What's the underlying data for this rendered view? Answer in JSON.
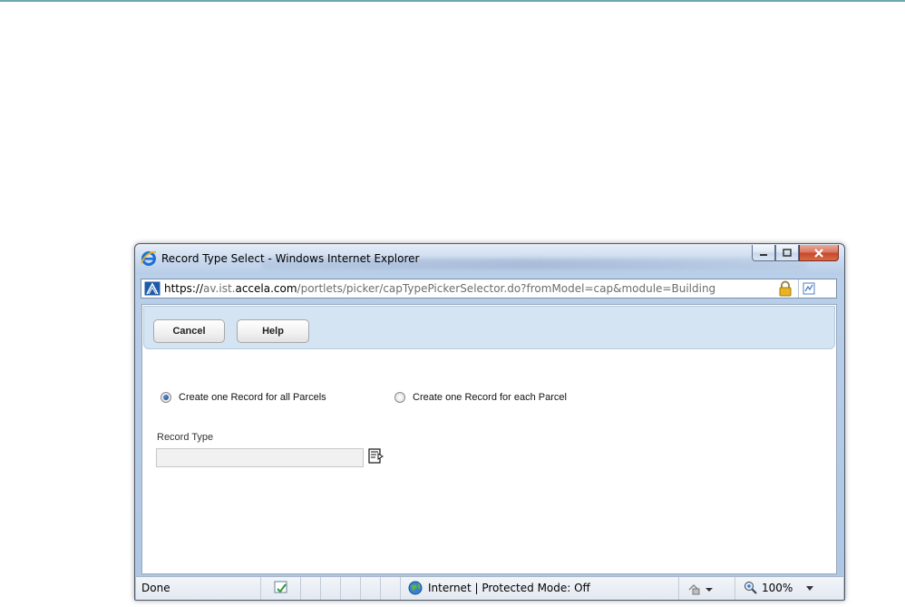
{
  "window": {
    "title": "Record Type Select - Windows Internet Explorer"
  },
  "address": {
    "scheme": "https://",
    "host_prefix": "av.ist.",
    "host": "accela.com",
    "path": "/portlets/picker/capTypePickerSelector.do?fromModel=cap&module=Building"
  },
  "toolbar": {
    "cancel_label": "Cancel",
    "help_label": "Help"
  },
  "form": {
    "radio_all_label": "Create one Record for all Parcels",
    "radio_each_label": "Create one Record for each Parcel",
    "selected_option": "all",
    "record_type_label": "Record Type",
    "record_type_value": ""
  },
  "statusbar": {
    "status": "Done",
    "zone": "Internet | Protected Mode: Off",
    "zoom": "100%"
  },
  "colors": {
    "top_rule": "#6aa9ad",
    "toolbar_bg": "#d4e4f2",
    "close_button": "#c7472a"
  }
}
